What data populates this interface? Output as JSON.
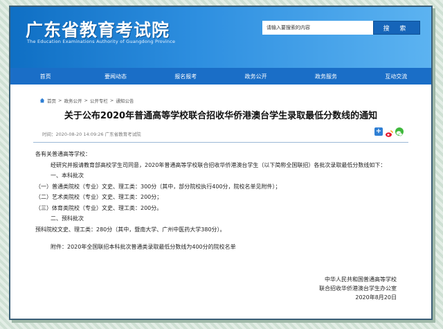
{
  "site": {
    "title_cn": "广东省教育考试院",
    "title_en": "The Education Examinations Authority of Guangdong Province"
  },
  "search": {
    "placeholder": "请输入要搜索的内容",
    "button": "搜 索"
  },
  "nav": [
    "首页",
    "要闻动态",
    "报名报考",
    "政务公开",
    "政务服务",
    "互动交流"
  ],
  "breadcrumb": [
    "首页",
    "政务公开",
    "公开专栏",
    "通知公告"
  ],
  "breadcrumb_sep": ">",
  "article": {
    "title": "关于公布2020年普通高等学校联合招收华侨港澳台学生录取最低分数线的通知",
    "meta": "时间：2020-08-20 14:09:26    广东省教育考试院",
    "paragraphs": [
      "各有关普通高等学校：",
      "经研究并报请教育部高校学生司同意，2020年普通高等学校联合招收华侨港澳台学生（以下简称全国联招）各批次录取最低分数线如下：",
      "一、本科批次",
      "（一）普通类院校（专业）文史、理工类：300分（其中，部分院校执行400分，院校名单见附件）；",
      "（二）艺术类院校（专业）文史、理工类：200分；",
      "（三）体育类院校（专业）文史、理工类：200分。",
      "二、预科批次",
      "预科院校文史、理工类：280分（其中，暨南大学、广州中医药大学380分）。",
      "附件：2020年全国联招本科批次普通类录取最低分数线为400分的院校名单"
    ],
    "signature": [
      "中华人民共和国普通高等学校",
      "联合招收华侨港澳台学生办公室",
      "2020年8月20日"
    ]
  },
  "colors": {
    "header_start": "#0f6fc4",
    "header_end": "#5cb3f1",
    "nav_bg": "#1a6ec7",
    "frame_border": "#3b5e77"
  }
}
